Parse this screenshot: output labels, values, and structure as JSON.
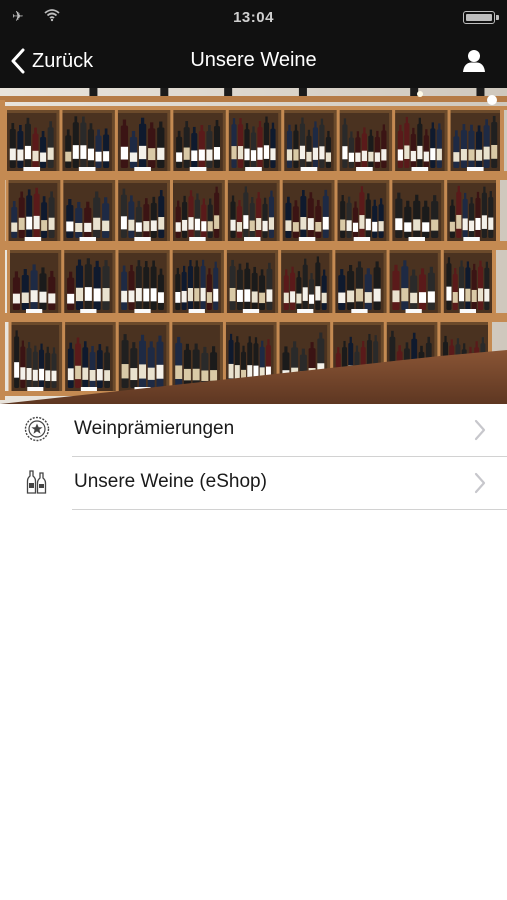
{
  "status_bar": {
    "time": "13:04",
    "icons": [
      "airplane-icon",
      "wifi-icon",
      "battery-icon"
    ]
  },
  "nav": {
    "back_label": "Zurück",
    "title": "Unsere Weine",
    "right_icon": "user-icon"
  },
  "hero": {
    "image_subject": "wine shelf",
    "wood_color": "#c48a52",
    "shadow_color": "#6b4a2b"
  },
  "menu": {
    "items": [
      {
        "label": "Weinprämierungen",
        "icon": "award-medal-icon"
      },
      {
        "label": "Unsere Weine (eShop)",
        "icon": "wine-bottles-icon"
      }
    ]
  },
  "colors": {
    "bar_background": "#111111",
    "bar_text": "#ffffff",
    "divider": "#d2d2d2",
    "chevron": "#c7c7cc"
  }
}
